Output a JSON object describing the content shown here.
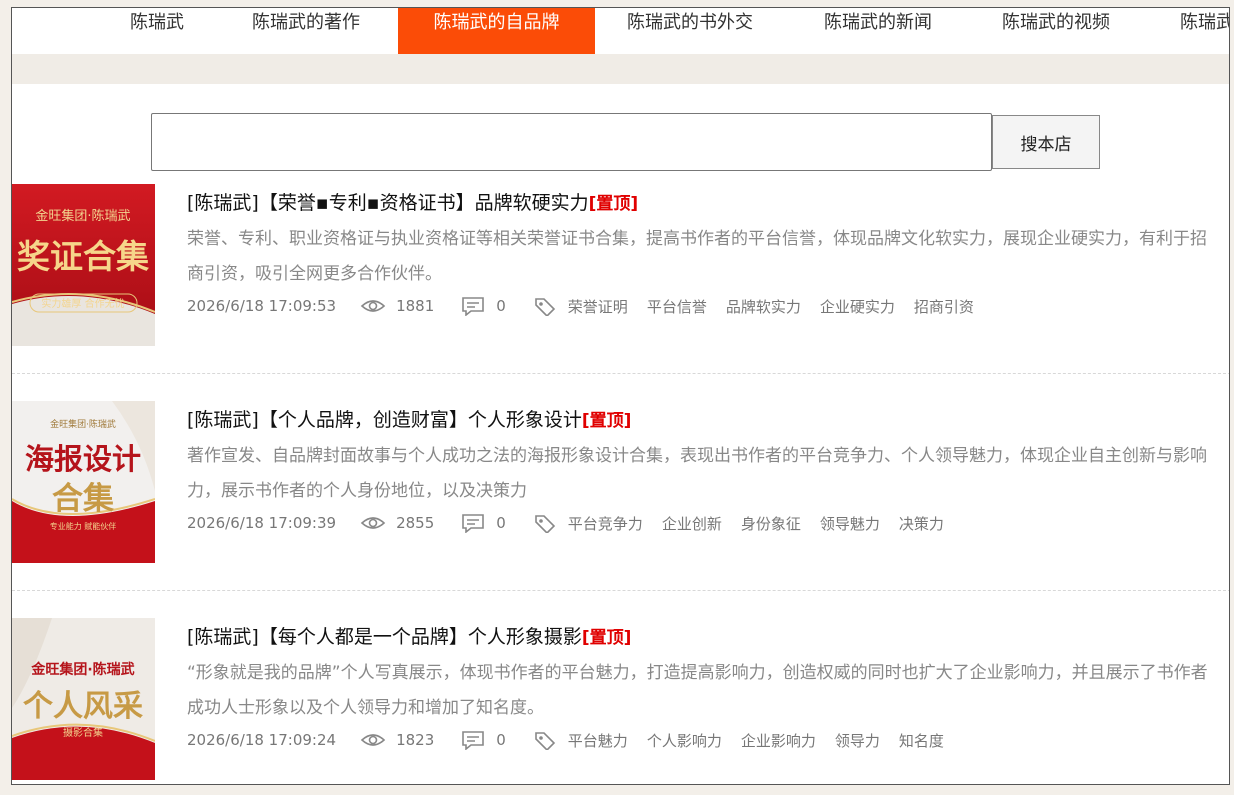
{
  "nav": {
    "items": [
      "陈瑞武",
      "陈瑞武的著作",
      "陈瑞武的自品牌",
      "陈瑞武的书外交",
      "陈瑞武的新闻",
      "陈瑞武的视频",
      "陈瑞武"
    ],
    "active_index": 2
  },
  "search": {
    "placeholder": "",
    "value": "",
    "button_label": "搜本店"
  },
  "colors": {
    "accent": "#fb4c07",
    "pin": "#e00000",
    "thumb_red": "#c4111a",
    "thumb_gold": "#e8c77a"
  },
  "articles": [
    {
      "title": "[陈瑞武]【荣誉▪专利▪资格证书】品牌软硬实力",
      "pin_label": "[置顶]",
      "description": "荣誉、专利、职业资格证与执业资格证等相关荣誉证书合集，提高书作者的平台信誉，体现品牌文化软实力，展现企业硬实力，有利于招商引资，吸引全网更多合作伙伴。",
      "date": "2026/6/18 17:09:53",
      "views": "1881",
      "comments": "0",
      "tags": [
        "荣誉证明",
        "平台信誉",
        "品牌软实力",
        "企业硬实力",
        "招商引资"
      ],
      "thumb": {
        "top": "金旺集团·陈瑞武",
        "main": "奖证合集",
        "sub": "实力雄厚 合作无忧"
      }
    },
    {
      "title": "[陈瑞武]【个人品牌，创造财富】个人形象设计",
      "pin_label": "[置顶]",
      "description": "著作宣发、自品牌封面故事与个人成功之法的海报形象设计合集，表现出书作者的平台竞争力、个人领导魅力，体现企业自主创新与影响力，展示书作者的个人身份地位，以及决策力",
      "date": "2026/6/18 17:09:39",
      "views": "2855",
      "comments": "0",
      "tags": [
        "平台竞争力",
        "企业创新",
        "身份象征",
        "领导魅力",
        "决策力"
      ],
      "thumb": {
        "top": "金旺集团·陈瑞武",
        "main": "海报设计",
        "main2": "合集",
        "sub": "专业能力 赋能伙伴"
      }
    },
    {
      "title": "[陈瑞武]【每个人都是一个品牌】个人形象摄影",
      "pin_label": "[置顶]",
      "description": "“形象就是我的品牌”个人写真展示，体现书作者的平台魅力，打造提高影响力，创造权威的同时也扩大了企业影响力，并且展示了书作者成功人士形象以及个人领导力和增加了知名度。",
      "date": "2026/6/18 17:09:24",
      "views": "1823",
      "comments": "0",
      "tags": [
        "平台魅力",
        "个人影响力",
        "企业影响力",
        "领导力",
        "知名度"
      ],
      "thumb": {
        "top": "金旺集团·陈瑞武",
        "main": "个人风采",
        "sub": "摄影合集"
      }
    }
  ]
}
